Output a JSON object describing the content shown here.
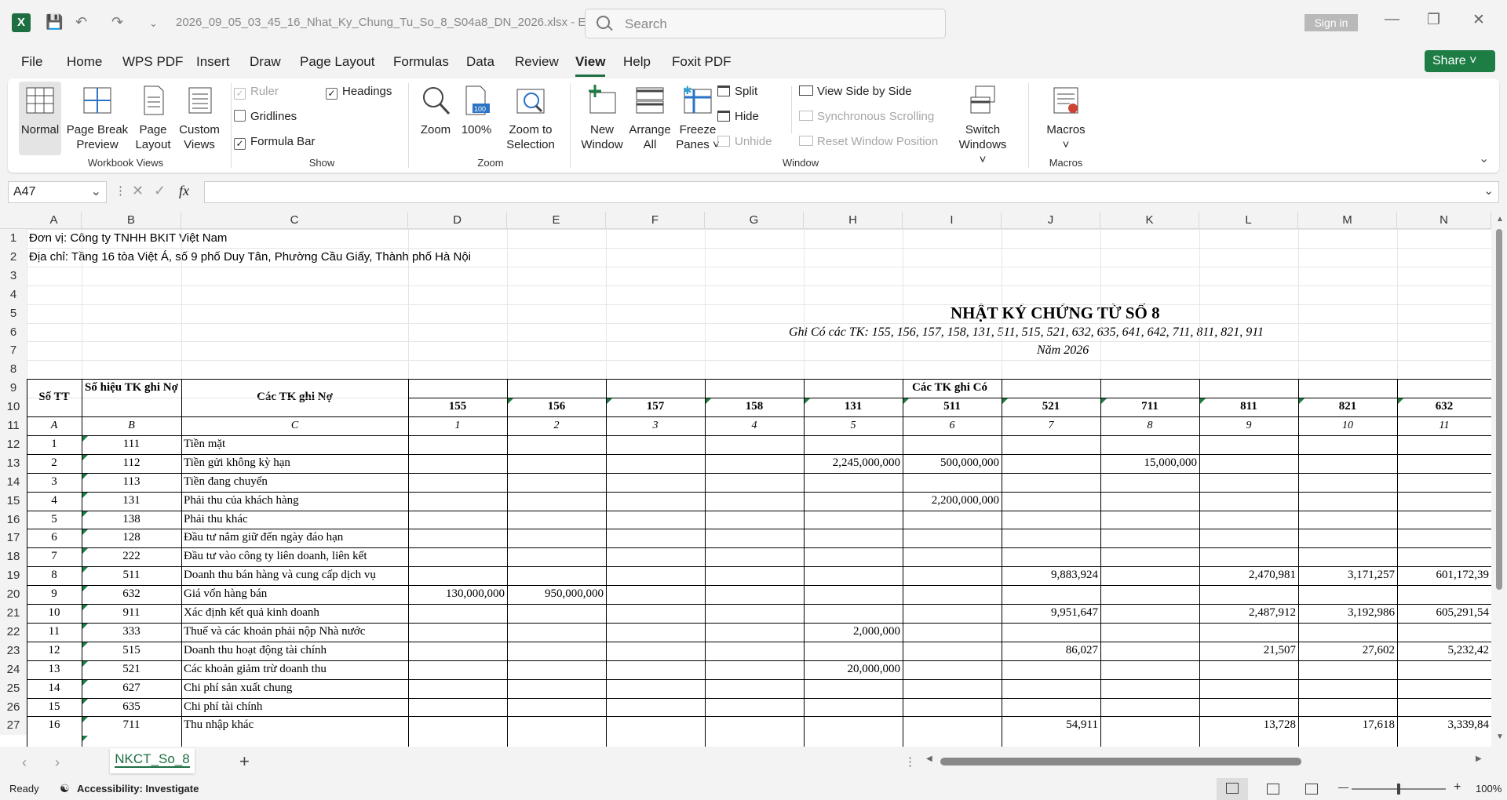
{
  "titlebar": {
    "filename": "2026_09_05_03_45_16_Nhat_Ky_Chung_Tu_So_8_S04a8_DN_2026.xlsx  -  E...",
    "search_placeholder": "Search",
    "signin": "Sign in",
    "app_icon": "X"
  },
  "menu": [
    "File",
    "Home",
    "WPS PDF",
    "Insert",
    "Draw",
    "Page Layout",
    "Formulas",
    "Data",
    "Review",
    "View",
    "Help",
    "Foxit PDF"
  ],
  "share": "Share",
  "ribbon": {
    "workbook_views": {
      "normal": "Normal",
      "page_break": [
        "Page Break",
        "Preview"
      ],
      "page_layout": [
        "Page",
        "Layout"
      ],
      "custom": [
        "Custom",
        "Views"
      ],
      "group": "Workbook Views"
    },
    "show": {
      "ruler": "Ruler",
      "gridlines": "Gridlines",
      "formula_bar": "Formula Bar",
      "headings": "Headings",
      "group": "Show"
    },
    "zoom": {
      "zoom": "Zoom",
      "pct": "100%",
      "selection": [
        "Zoom to",
        "Selection"
      ],
      "group": "Zoom"
    },
    "window": {
      "new": [
        "New",
        "Window"
      ],
      "arrange": [
        "Arrange",
        "All"
      ],
      "freeze": [
        "Freeze",
        "Panes ˅"
      ],
      "split": "Split",
      "hide": "Hide",
      "unhide": "Unhide",
      "side": "View Side by Side",
      "sync": "Synchronous Scrolling",
      "reset": "Reset Window Position",
      "switch": [
        "Switch",
        "Windows ˅"
      ],
      "group": "Window"
    },
    "macros": {
      "macros": "Macros",
      "group": "Macros"
    }
  },
  "namebox": "A47",
  "columns": [
    "A",
    "B",
    "C",
    "D",
    "E",
    "F",
    "G",
    "H",
    "I",
    "J",
    "K",
    "L",
    "M",
    "N"
  ],
  "rows": [
    "1",
    "2",
    "3",
    "4",
    "5",
    "6",
    "7",
    "8",
    "9",
    "10",
    "11",
    "12",
    "13",
    "14",
    "15",
    "16",
    "17",
    "18",
    "19",
    "20",
    "21",
    "22",
    "23",
    "24",
    "25",
    "26",
    "27"
  ],
  "sheet": {
    "r1": "Đơn vị: Công ty TNHH BKIT Việt Nam",
    "r2": "Địa chỉ: Tầng 16 tòa Việt Á, số 9 phố Duy Tân, Phường Cầu Giấy, Thành phố Hà Nội",
    "title": "NHẬT KÝ CHỨNG TỪ SỐ 8",
    "subtitle": "Ghi Có các TK: 155, 156, 157, 158, 131, 511, 515, 521, 632, 635, 641, 642, 711, 811, 821, 911",
    "year": "Năm 2026",
    "h_stt": "Số TT",
    "h_sohieu": "Số hiệu TK ghi Nợ",
    "h_no": "Các TK ghi Nợ",
    "h_co": "Các TK ghi Có",
    "accts": [
      "155",
      "156",
      "157",
      "158",
      "131",
      "511",
      "521",
      "711",
      "811",
      "821",
      "632"
    ],
    "sub": [
      "A",
      "B",
      "C",
      "1",
      "2",
      "3",
      "4",
      "5",
      "6",
      "7",
      "8",
      "9",
      "10",
      "11"
    ]
  },
  "data_rows": [
    {
      "stt": "1",
      "tk": "111",
      "name": "Tiền mặt",
      "v": [
        "",
        "",
        "",
        "",
        "",
        "",
        "",
        "",
        "",
        "",
        ""
      ]
    },
    {
      "stt": "2",
      "tk": "112",
      "name": "Tiền gửi không kỳ hạn",
      "v": [
        "",
        "",
        "",
        "",
        "2,245,000,000",
        "500,000,000",
        "",
        "15,000,000",
        "",
        "",
        ""
      ]
    },
    {
      "stt": "3",
      "tk": "113",
      "name": "Tiền đang chuyển",
      "v": [
        "",
        "",
        "",
        "",
        "",
        "",
        "",
        "",
        "",
        "",
        ""
      ]
    },
    {
      "stt": "4",
      "tk": "131",
      "name": "Phải thu của khách hàng",
      "v": [
        "",
        "",
        "",
        "",
        "",
        "2,200,000,000",
        "",
        "",
        "",
        "",
        ""
      ]
    },
    {
      "stt": "5",
      "tk": "138",
      "name": "Phải thu khác",
      "v": [
        "",
        "",
        "",
        "",
        "",
        "",
        "",
        "",
        "",
        "",
        ""
      ]
    },
    {
      "stt": "6",
      "tk": "128",
      "name": "Đầu tư nắm giữ đến ngày đáo hạn",
      "v": [
        "",
        "",
        "",
        "",
        "",
        "",
        "",
        "",
        "",
        "",
        ""
      ]
    },
    {
      "stt": "7",
      "tk": "222",
      "name": "Đầu tư vào công ty liên doanh, liên kết",
      "v": [
        "",
        "",
        "",
        "",
        "",
        "",
        "",
        "",
        "",
        "",
        ""
      ]
    },
    {
      "stt": "8",
      "tk": "511",
      "name": "Doanh thu bán hàng và cung cấp dịch vụ",
      "v": [
        "",
        "",
        "",
        "",
        "",
        "",
        "9,883,924",
        "",
        "2,470,981",
        "3,171,257",
        "601,172,39"
      ]
    },
    {
      "stt": "9",
      "tk": "632",
      "name": "Giá vốn hàng bán",
      "v": [
        "130,000,000",
        "950,000,000",
        "",
        "",
        "",
        "",
        "",
        "",
        "",
        "",
        ""
      ]
    },
    {
      "stt": "10",
      "tk": "911",
      "name": "Xác định kết quả kinh doanh",
      "v": [
        "",
        "",
        "",
        "",
        "",
        "",
        "9,951,647",
        "",
        "2,487,912",
        "3,192,986",
        "605,291,54"
      ]
    },
    {
      "stt": "11",
      "tk": "333",
      "name": "Thuế và các khoản phải nộp Nhà nước",
      "v": [
        "",
        "",
        "",
        "",
        "2,000,000",
        "",
        "",
        "",
        "",
        "",
        ""
      ]
    },
    {
      "stt": "12",
      "tk": "515",
      "name": "Doanh thu hoạt động tài chính",
      "v": [
        "",
        "",
        "",
        "",
        "",
        "",
        "86,027",
        "",
        "21,507",
        "27,602",
        "5,232,42"
      ]
    },
    {
      "stt": "13",
      "tk": "521",
      "name": "Các khoản giảm trừ doanh thu",
      "v": [
        "",
        "",
        "",
        "",
        "20,000,000",
        "",
        "",
        "",
        "",
        "",
        ""
      ]
    },
    {
      "stt": "14",
      "tk": "627",
      "name": "Chi phí sản xuất chung",
      "v": [
        "",
        "",
        "",
        "",
        "",
        "",
        "",
        "",
        "",
        "",
        ""
      ]
    },
    {
      "stt": "15",
      "tk": "635",
      "name": "Chi phí tài chính",
      "v": [
        "",
        "",
        "",
        "",
        "",
        "",
        "",
        "",
        "",
        "",
        ""
      ]
    },
    {
      "stt": "16",
      "tk": "711",
      "name": "Thu nhập khác",
      "v": [
        "",
        "",
        "",
        "",
        "",
        "",
        "54,911",
        "",
        "13,728",
        "17,618",
        "3,339,84"
      ]
    }
  ],
  "tabs": {
    "sheet": "NKCT_So_8"
  },
  "status": {
    "ready": "Ready",
    "access": "Accessibility: Investigate",
    "zoom": "100%"
  }
}
